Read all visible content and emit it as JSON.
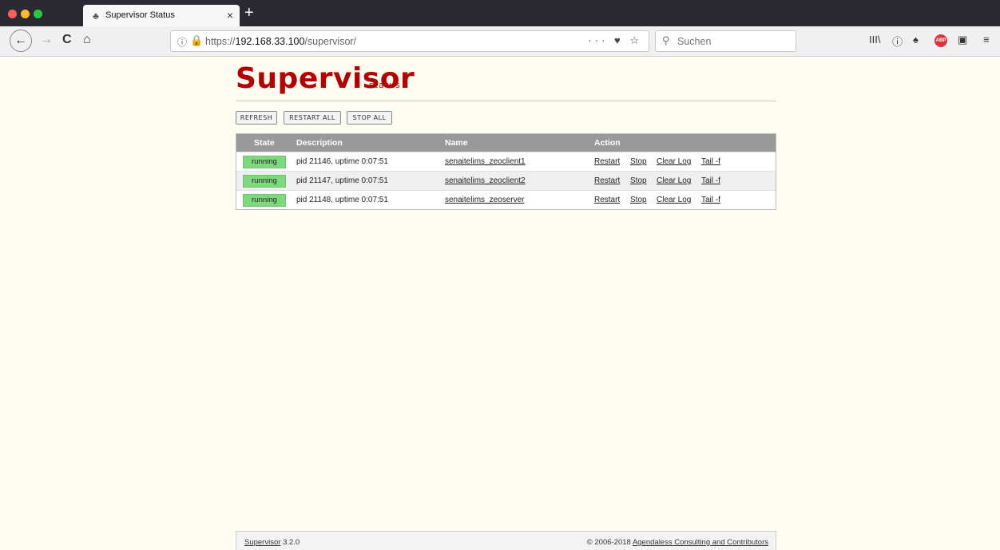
{
  "browser": {
    "tab_title": "Supervisor Status",
    "tab_close": "×",
    "new_tab": "+",
    "url_prefix": "https://",
    "url_host": "192.168.33.100",
    "url_path": "/supervisor/",
    "url_actions": "··· ♥ ☆",
    "search_placeholder": "Suchen",
    "search_icon": "⚲",
    "back_icon": "←",
    "forward_icon": "→",
    "reload_icon": "C",
    "home_icon": "⌂",
    "icons": [
      "library-icon",
      "info-icon",
      "extension-icon",
      "adblock-icon",
      "sidebar-icon",
      "menu-icon"
    ],
    "colors": {
      "chrome_dark": "#2b2a33",
      "close": "#fe5f57",
      "minimize": "#febc2e",
      "maximize": "#28c840"
    }
  },
  "page": {
    "logo": "Supervisor",
    "logo_sub": "status",
    "buttons": {
      "refresh": "REFRESH",
      "restart_all": "RESTART ALL",
      "stop_all": "STOP ALL"
    },
    "table": {
      "headers": {
        "state": "State",
        "description": "Description",
        "name": "Name",
        "action": "Action"
      },
      "rows": [
        {
          "state": "running",
          "description": "pid 21146, uptime 0:07:51",
          "name": "senaitelims_zeoclient1"
        },
        {
          "state": "running",
          "description": "pid 21147, uptime 0:07:51",
          "name": "senaitelims_zeoclient2"
        },
        {
          "state": "running",
          "description": "pid 21148, uptime 0:07:51",
          "name": "senaitelims_zeoserver"
        }
      ],
      "actions": {
        "restart": "Restart",
        "stop": "Stop",
        "clear_log": "Clear Log",
        "tail": "Tail -f"
      }
    },
    "footer": {
      "product": "Supervisor",
      "version": "3.2.0",
      "copyright": "© 2006-2018",
      "org": "Agendaless Consulting and Contributors"
    },
    "colors": {
      "brand": "#b20000",
      "running": "#7ed87e",
      "header_bg": "#999999",
      "page_bg": "#fdfdf2"
    }
  }
}
